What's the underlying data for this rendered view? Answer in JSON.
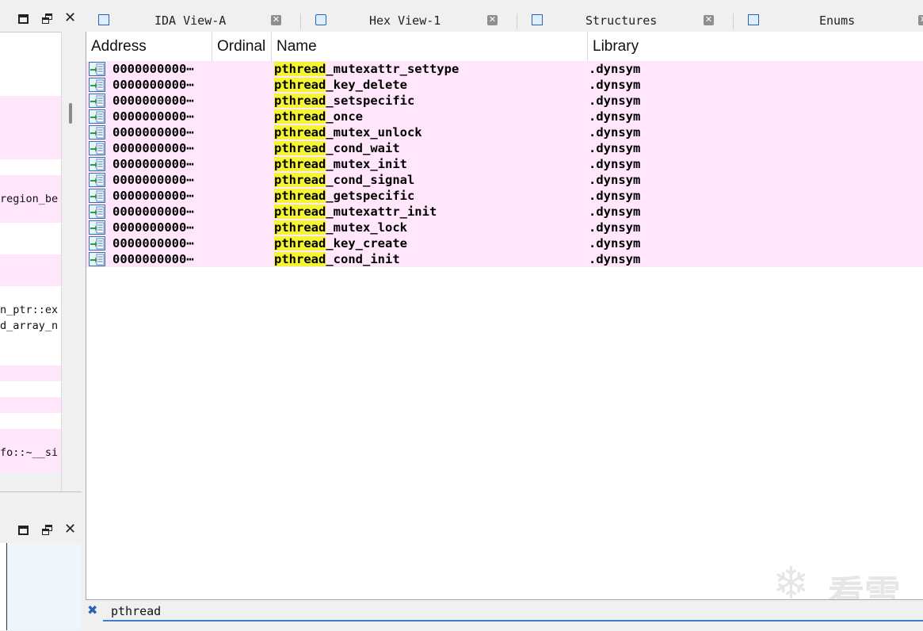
{
  "left_pane": {
    "partial_rows": [
      {
        "text": "",
        "pink": false
      },
      {
        "text": "",
        "pink": false
      },
      {
        "text": "",
        "pink": false
      },
      {
        "text": "",
        "pink": false
      },
      {
        "text": "",
        "pink": true
      },
      {
        "text": "",
        "pink": true
      },
      {
        "text": "",
        "pink": true
      },
      {
        "text": "",
        "pink": true
      },
      {
        "text": "",
        "pink": false
      },
      {
        "text": "",
        "pink": true
      },
      {
        "text": "region_be",
        "pink": true
      },
      {
        "text": "",
        "pink": true
      },
      {
        "text": "",
        "pink": false
      },
      {
        "text": "",
        "pink": false
      },
      {
        "text": "",
        "pink": true
      },
      {
        "text": "",
        "pink": true
      },
      {
        "text": "",
        "pink": false
      },
      {
        "text": "n_ptr::ex",
        "pink": false
      },
      {
        "text": "d_array_n",
        "pink": false
      },
      {
        "text": "",
        "pink": false
      },
      {
        "text": "",
        "pink": false
      },
      {
        "text": "",
        "pink": true
      },
      {
        "text": "",
        "pink": false
      },
      {
        "text": "",
        "pink": true
      },
      {
        "text": "",
        "pink": false
      },
      {
        "text": "",
        "pink": true
      },
      {
        "text": "fo::~__si",
        "pink": true
      },
      {
        "text": "",
        "pink": true
      }
    ]
  },
  "tabs": [
    {
      "label": "IDA View-A",
      "icon": "ida-view-icon"
    },
    {
      "label": "Hex View-1",
      "icon": "hex-view-icon"
    },
    {
      "label": "Structures",
      "icon": "structures-icon"
    },
    {
      "label": "Enums",
      "icon": "enums-icon"
    }
  ],
  "table": {
    "columns": [
      "Address",
      "Ordinal",
      "Name",
      "Library"
    ],
    "rows": [
      {
        "address": "0000000000⋯",
        "ordinal": "",
        "name_match": "pthread",
        "name_rest": "_mutexattr_settype",
        "library": ".dynsym"
      },
      {
        "address": "0000000000⋯",
        "ordinal": "",
        "name_match": "pthread",
        "name_rest": "_key_delete",
        "library": ".dynsym"
      },
      {
        "address": "0000000000⋯",
        "ordinal": "",
        "name_match": "pthread",
        "name_rest": "_setspecific",
        "library": ".dynsym"
      },
      {
        "address": "0000000000⋯",
        "ordinal": "",
        "name_match": "pthread",
        "name_rest": "_once",
        "library": ".dynsym"
      },
      {
        "address": "0000000000⋯",
        "ordinal": "",
        "name_match": "pthread",
        "name_rest": "_mutex_unlock",
        "library": ".dynsym"
      },
      {
        "address": "0000000000⋯",
        "ordinal": "",
        "name_match": "pthread",
        "name_rest": "_cond_wait",
        "library": ".dynsym"
      },
      {
        "address": "0000000000⋯",
        "ordinal": "",
        "name_match": "pthread",
        "name_rest": "_mutex_init",
        "library": ".dynsym"
      },
      {
        "address": "0000000000⋯",
        "ordinal": "",
        "name_match": "pthread",
        "name_rest": "_cond_signal",
        "library": ".dynsym"
      },
      {
        "address": "0000000000⋯",
        "ordinal": "",
        "name_match": "pthread",
        "name_rest": "_getspecific",
        "library": ".dynsym"
      },
      {
        "address": "0000000000⋯",
        "ordinal": "",
        "name_match": "pthread",
        "name_rest": "_mutexattr_init",
        "library": ".dynsym"
      },
      {
        "address": "0000000000⋯",
        "ordinal": "",
        "name_match": "pthread",
        "name_rest": "_mutex_lock",
        "library": ".dynsym"
      },
      {
        "address": "0000000000⋯",
        "ordinal": "",
        "name_match": "pthread",
        "name_rest": "_key_create",
        "library": ".dynsym"
      },
      {
        "address": "0000000000⋯",
        "ordinal": "",
        "name_match": "pthread",
        "name_rest": "_cond_init",
        "library": ".dynsym"
      }
    ]
  },
  "filter": {
    "value": "pthread"
  },
  "watermark": {
    "text": "看雪"
  },
  "colors": {
    "row_background": "#ffe6fb",
    "match_highlight": "#f5f536",
    "accent": "#3b7fd1"
  }
}
